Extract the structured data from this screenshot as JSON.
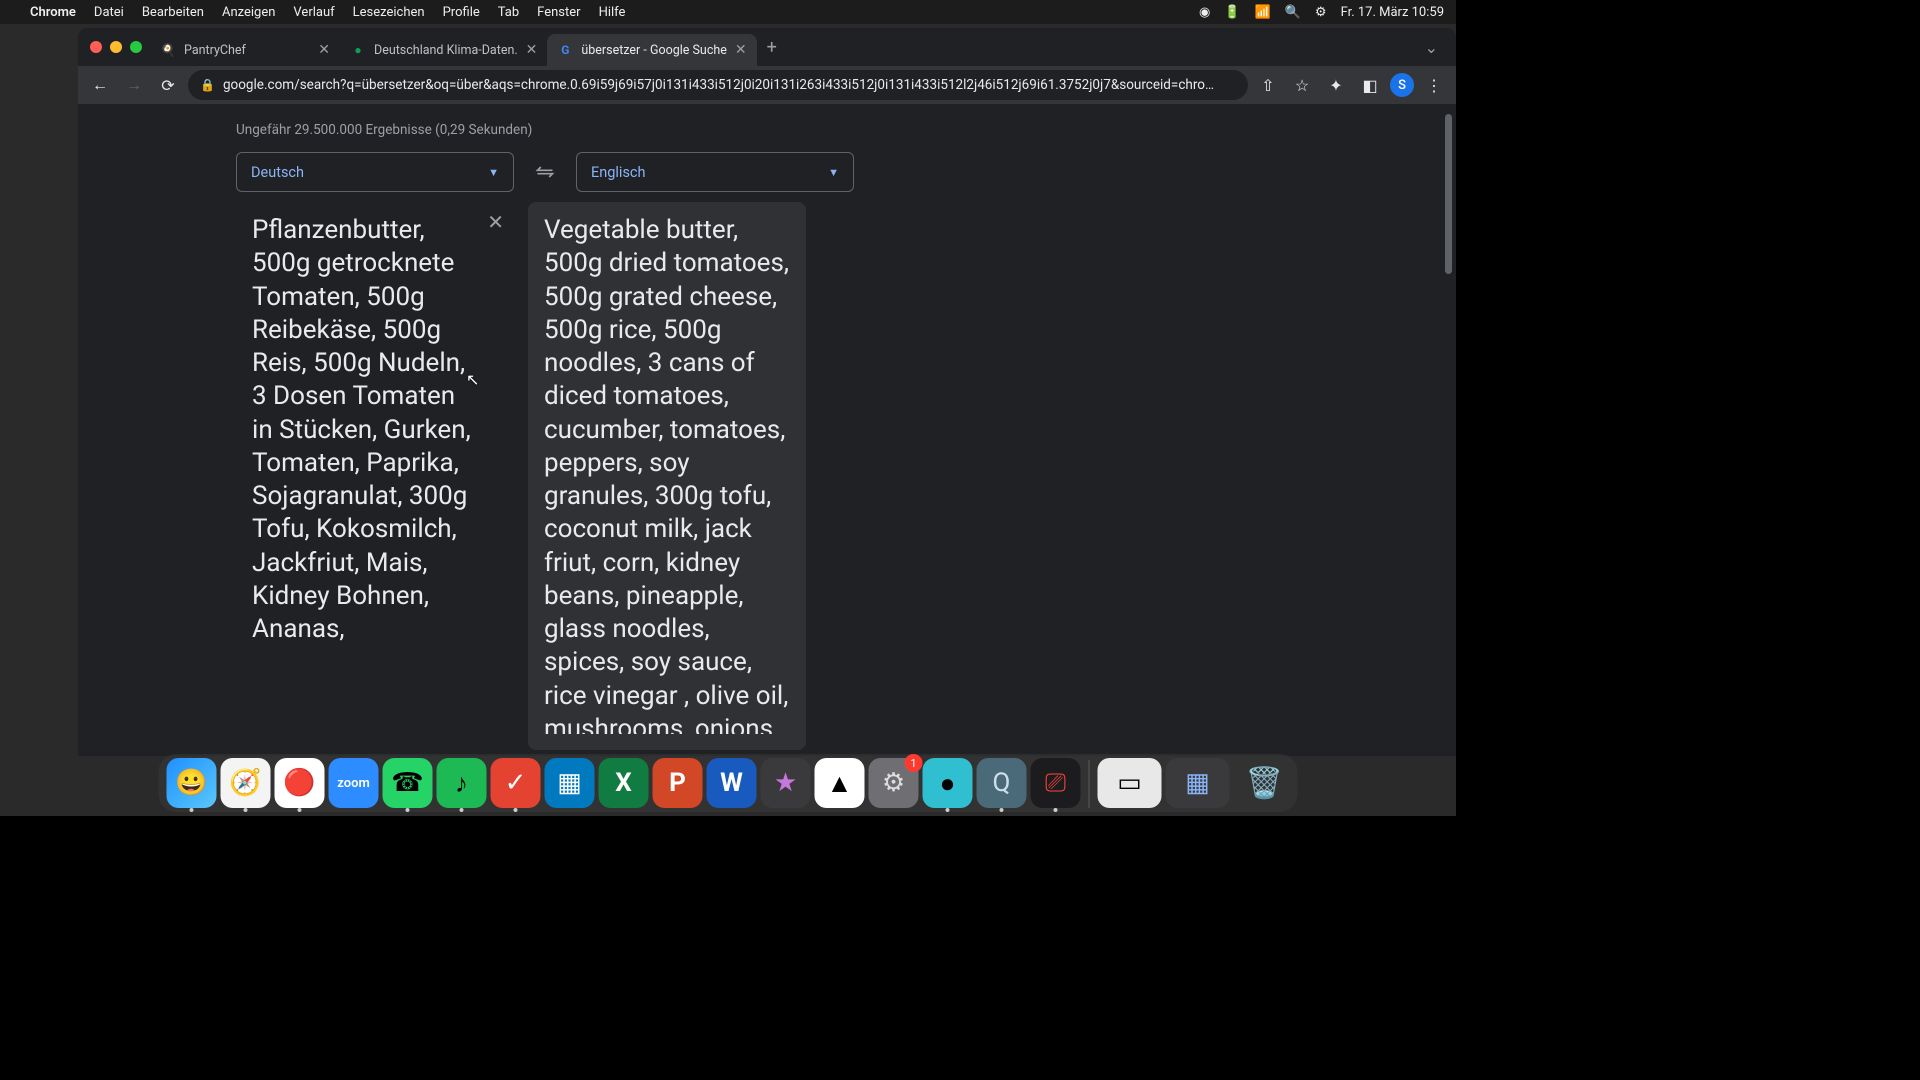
{
  "menubar": {
    "app": "Chrome",
    "items": [
      "Datei",
      "Bearbeiten",
      "Anzeigen",
      "Verlauf",
      "Lesezeichen",
      "Profile",
      "Tab",
      "Fenster",
      "Hilfe"
    ],
    "clock": "Fr. 17. März  10:59"
  },
  "tabs": [
    {
      "title": "PantryChef",
      "favicon": "🍳"
    },
    {
      "title": "Deutschland Klima-Daten.",
      "favicon": "●"
    },
    {
      "title": "übersetzer - Google Suche",
      "favicon": "G"
    }
  ],
  "active_tab": 2,
  "url": "google.com/search?q=übersetzer&oq=über&aqs=chrome.0.69i59j69i57j0i131i433i512j0i20i131i263i433i512j0i131i433i512l2j46i512j69i61.3752j0j7&sourceid=chro…",
  "avatar_letter": "S",
  "results_info": "Ungefähr 29.500.000 Ergebnisse (0,29 Sekunden)",
  "translator": {
    "src_lang": "Deutsch",
    "dst_lang": "Englisch",
    "src_text": "Pflanzenbutter, 500g getrocknete Tomaten, 500g Reibekäse, 500g Reis, 500g Nudeln, 3 Dosen Tomaten in Stücken, Gurken, Tomaten, Paprika, Sojagranulat, 300g Tofu, Kokosmilch, Jackfriut, Mais, Kidney Bohnen, Ananas,",
    "dst_text": "Vegetable butter, 500g dried tomatoes, 500g grated cheese, 500g rice, 500g noodles, 3 cans of diced tomatoes, cucumber, tomatoes, peppers, soy granules, 300g tofu, coconut milk, jack friut, corn, kidney beans, pineapple, glass noodles, spices, soy sauce, rice vinegar , olive oil, mushrooms, onions,"
  },
  "dock": [
    {
      "name": "finder",
      "emoji": "🔵",
      "bg": "#1e90ff",
      "running": true
    },
    {
      "name": "safari",
      "emoji": "🧭",
      "bg": "#f4f4f4",
      "running": true
    },
    {
      "name": "chrome",
      "emoji": "🌐",
      "bg": "#fff",
      "running": true
    },
    {
      "name": "zoom",
      "emoji": "📹",
      "bg": "#2d8cff",
      "running": false,
      "label": "zoom"
    },
    {
      "name": "whatsapp",
      "emoji": "💬",
      "bg": "#25d366",
      "running": true
    },
    {
      "name": "spotify",
      "emoji": "♪",
      "bg": "#1db954",
      "running": true
    },
    {
      "name": "todoist",
      "emoji": "✓",
      "bg": "#e44332",
      "running": true
    },
    {
      "name": "trello",
      "emoji": "▦",
      "bg": "#0079bf",
      "running": false
    },
    {
      "name": "excel",
      "emoji": "X",
      "bg": "#107c41",
      "running": false
    },
    {
      "name": "powerpoint",
      "emoji": "P",
      "bg": "#d24726",
      "running": false
    },
    {
      "name": "word",
      "emoji": "W",
      "bg": "#185abd",
      "running": false
    },
    {
      "name": "imovie",
      "emoji": "★",
      "bg": "#3a3a3c",
      "running": false
    },
    {
      "name": "drive",
      "emoji": "▲",
      "bg": "#fff",
      "running": false
    },
    {
      "name": "settings",
      "emoji": "⚙",
      "bg": "#6e6e73",
      "running": false,
      "badge": "1"
    },
    {
      "name": "app-a",
      "emoji": "●",
      "bg": "#2fbfd0",
      "running": true
    },
    {
      "name": "quicktime",
      "emoji": "Q",
      "bg": "#4a6a7a",
      "running": true
    },
    {
      "name": "voice",
      "emoji": "⎚",
      "bg": "#1c1c1e",
      "running": true
    }
  ]
}
